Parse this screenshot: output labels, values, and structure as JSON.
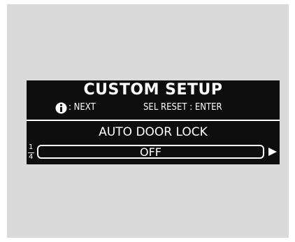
{
  "screen": {
    "title": "CUSTOM SETUP",
    "hints": {
      "next": ": NEXT",
      "reset": "SEL RESET : ENTER"
    },
    "setting": {
      "name": "AUTO DOOR LOCK",
      "value": "OFF"
    },
    "page": {
      "current": "1",
      "total": "4"
    }
  },
  "icons": {
    "info": "info-icon",
    "next": "triangle-right-icon"
  },
  "colors": {
    "lcd_background": "#0e0e0e",
    "lcd_text": "#ffffff",
    "frame": "#dadada"
  }
}
